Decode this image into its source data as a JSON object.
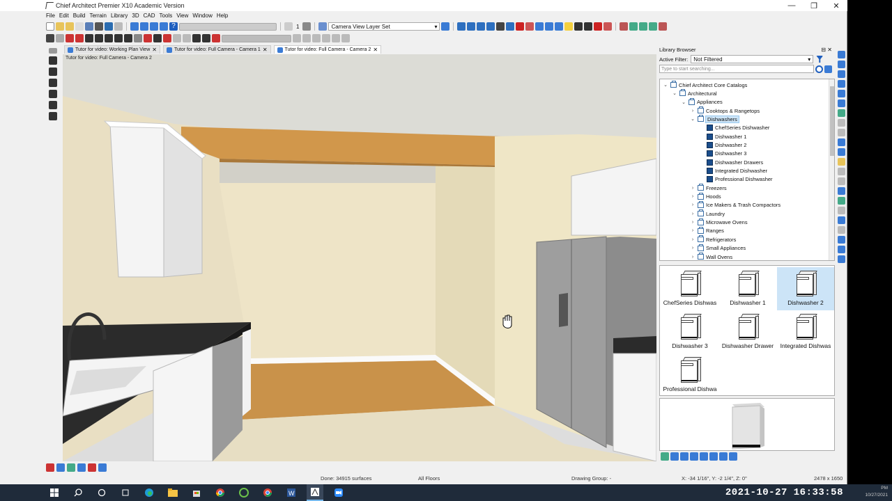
{
  "window": {
    "title": "Chief Architect Premier X10 Academic Version",
    "controls": [
      "—",
      "❐",
      "✕"
    ]
  },
  "menu": [
    "File",
    "Edit",
    "Build",
    "Terrain",
    "Library",
    "3D",
    "CAD",
    "Tools",
    "View",
    "Window",
    "Help"
  ],
  "toolbar": {
    "floor_number": "1",
    "layer_set": "Camera View Layer Set"
  },
  "tabs": [
    {
      "label": "Tutor for video:  Working Plan View",
      "close": "✕",
      "active": false
    },
    {
      "label": "Tutor for video: Full Camera - Camera 1",
      "close": "✕",
      "active": false
    },
    {
      "label": "Tutor for video: Full Camera - Camera 2",
      "close": "✕",
      "active": true
    }
  ],
  "viewport": {
    "label": "Tutor for video: Full Camera - Camera 2"
  },
  "library": {
    "title": "Library Browser",
    "pin": "⊟ ✕",
    "active_filter_label": "Active Filter:",
    "active_filter_value": "Not Filtered",
    "search_placeholder": "Type to start searching...",
    "tree": [
      {
        "label": "Chief Architect Core Catalogs",
        "level": 0,
        "expanded": true,
        "kind": "catalog"
      },
      {
        "label": "Architectural",
        "level": 1,
        "expanded": true,
        "kind": "folder"
      },
      {
        "label": "Appliances",
        "level": 2,
        "expanded": true,
        "kind": "folder"
      },
      {
        "label": "Cooktops & Rangetops",
        "level": 3,
        "expanded": false,
        "kind": "folder"
      },
      {
        "label": "Dishwashers",
        "level": 3,
        "expanded": true,
        "kind": "folder",
        "selected": true
      },
      {
        "label": "ChefSeries Dishwasher",
        "level": 4,
        "kind": "object"
      },
      {
        "label": "Dishwasher 1",
        "level": 4,
        "kind": "object"
      },
      {
        "label": "Dishwasher 2",
        "level": 4,
        "kind": "object"
      },
      {
        "label": "Dishwasher 3",
        "level": 4,
        "kind": "object"
      },
      {
        "label": "Dishwasher Drawers",
        "level": 4,
        "kind": "object"
      },
      {
        "label": "Integrated Dishwasher",
        "level": 4,
        "kind": "object"
      },
      {
        "label": "Professional Dishwasher",
        "level": 4,
        "kind": "object"
      },
      {
        "label": "Freezers",
        "level": 3,
        "expanded": false,
        "kind": "folder"
      },
      {
        "label": "Hoods",
        "level": 3,
        "expanded": false,
        "kind": "folder"
      },
      {
        "label": "Ice Makers & Trash Compactors",
        "level": 3,
        "expanded": false,
        "kind": "folder"
      },
      {
        "label": "Laundry",
        "level": 3,
        "expanded": false,
        "kind": "folder"
      },
      {
        "label": "Microwave Ovens",
        "level": 3,
        "expanded": false,
        "kind": "folder"
      },
      {
        "label": "Ranges",
        "level": 3,
        "expanded": false,
        "kind": "folder"
      },
      {
        "label": "Refrigerators",
        "level": 3,
        "expanded": false,
        "kind": "folder"
      },
      {
        "label": "Small Appliances",
        "level": 3,
        "expanded": false,
        "kind": "folder"
      },
      {
        "label": "Wall Ovens",
        "level": 3,
        "expanded": false,
        "kind": "folder"
      }
    ],
    "previews": [
      {
        "label": "ChefSeries Dishwas",
        "selected": false
      },
      {
        "label": "Dishwasher 1",
        "selected": false
      },
      {
        "label": "Dishwasher 2",
        "selected": true
      },
      {
        "label": "Dishwasher 3",
        "selected": false
      },
      {
        "label": "Dishwasher Drawer",
        "selected": false
      },
      {
        "label": "Integrated Dishwas",
        "selected": false
      },
      {
        "label": "Professional Dishwa",
        "selected": false
      }
    ]
  },
  "status": {
    "done": "Done:  34915 surfaces",
    "floors": "All Floors",
    "drawing_group": "Drawing Group: -",
    "coords": "X: -34 1/16\", Y: -2 1/4\", Z: 0\"",
    "resolution": "2478 x 1650"
  },
  "taskbar": {
    "clock": "2021-10-27 16:33:58",
    "tray_time": "PM",
    "tray_date": "10/27/2021"
  },
  "colors": {
    "accent": "#0078d7",
    "selection": "#cce4f7",
    "taskbar": "#1f2b3a",
    "wall": "#ece3c8",
    "beam": "#d49a4c",
    "floor_wood": "#c9924a"
  }
}
